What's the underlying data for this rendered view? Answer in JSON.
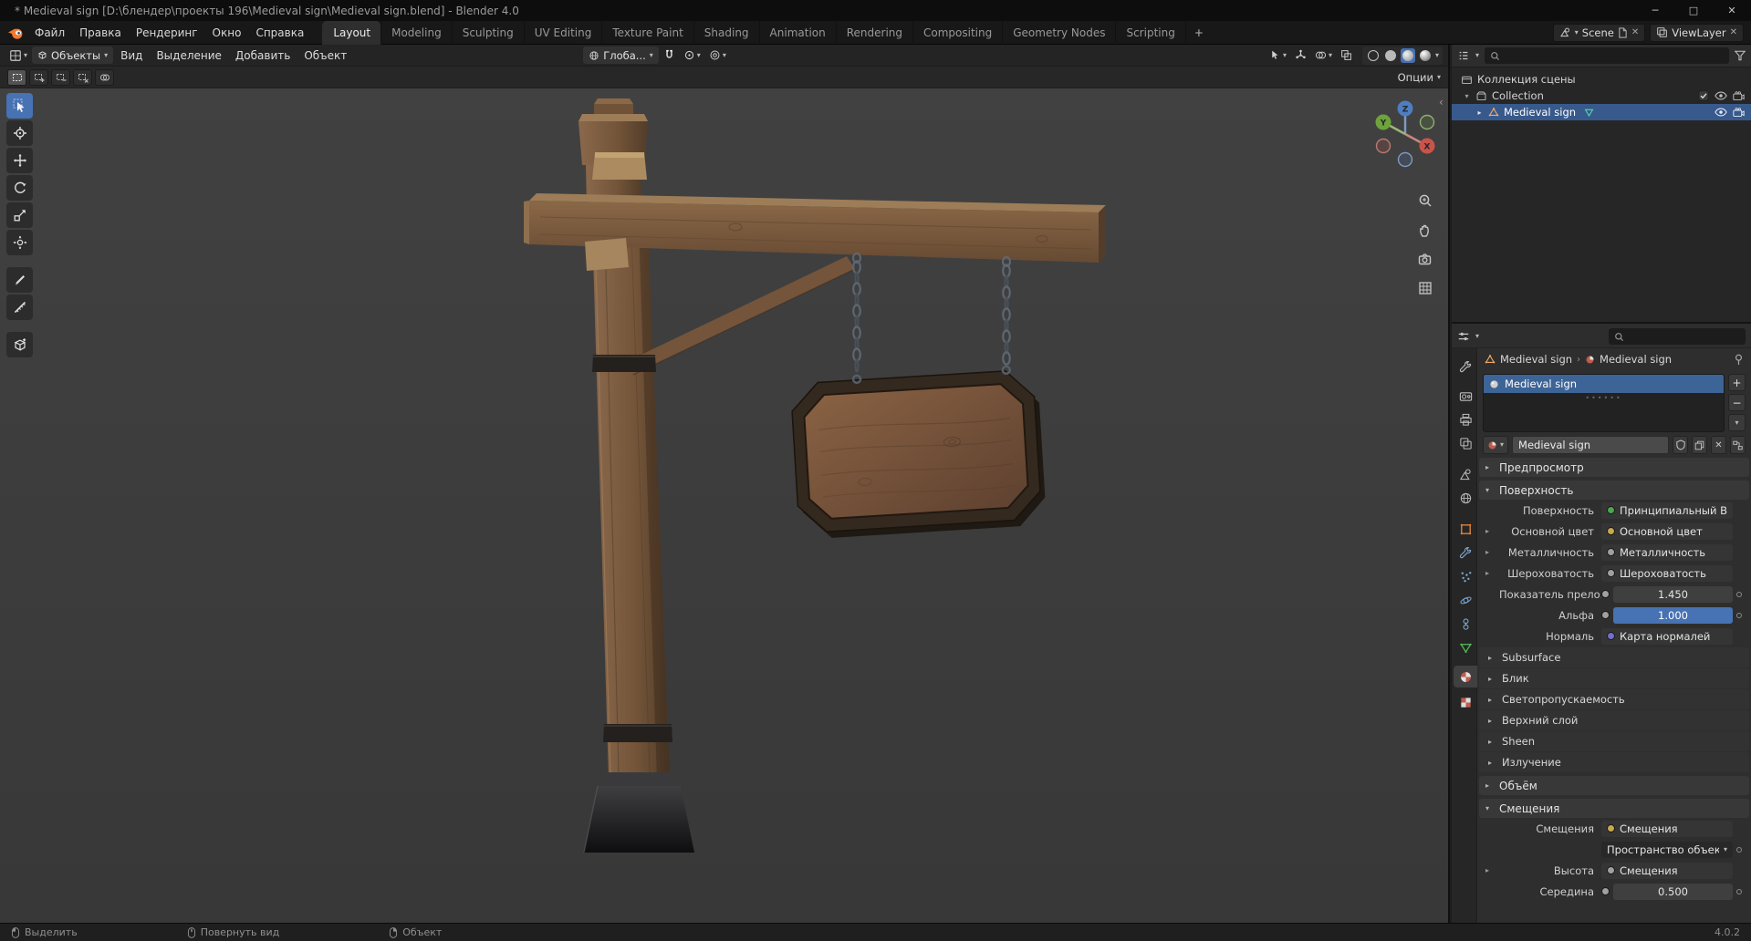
{
  "colors": {
    "accent": "#4772b3",
    "selection_row": "#37598c",
    "viewport_bg": "#3d3d3d",
    "socket_shader": "#4ca64c",
    "socket_color": "#c7a84c",
    "socket_float": "#a0a0a0",
    "socket_vector": "#7070c8",
    "object_orange": "#e8883a",
    "data_green": "#55c055",
    "material_red": "#bf5b4d"
  },
  "window": {
    "title": "* Medieval sign [D:\\блендер\\проекты 196\\Medieval sign\\Medieval sign.blend] - Blender 4.0",
    "minimize": "─",
    "maximize": "□",
    "close": "✕"
  },
  "topbar": {
    "menus": [
      {
        "label": "Файл"
      },
      {
        "label": "Правка"
      },
      {
        "label": "Рендеринг"
      },
      {
        "label": "Окно"
      },
      {
        "label": "Справка"
      }
    ],
    "workspaces": [
      {
        "label": "Layout"
      },
      {
        "label": "Modeling"
      },
      {
        "label": "Sculpting"
      },
      {
        "label": "UV Editing"
      },
      {
        "label": "Texture Paint"
      },
      {
        "label": "Shading"
      },
      {
        "label": "Animation"
      },
      {
        "label": "Rendering"
      },
      {
        "label": "Compositing"
      },
      {
        "label": "Geometry Nodes"
      },
      {
        "label": "Scripting"
      }
    ],
    "add_tab": "+",
    "scene": "Scene",
    "viewlayer": "ViewLayer"
  },
  "viewport_header": {
    "mode": "Объекты",
    "menu_view": "Вид",
    "menu_select": "Выделение",
    "menu_add": "Добавить",
    "menu_object": "Объект",
    "orientation": "Глоба...",
    "options": "Опции"
  },
  "gizmo": {
    "x": "X",
    "y": "Y",
    "z": "Z"
  },
  "outliner": {
    "rows": [
      {
        "label": "Коллекция сцены"
      },
      {
        "label": "Collection"
      },
      {
        "label": "Medieval sign"
      }
    ]
  },
  "properties": {
    "breadcrumb_object": "Medieval sign",
    "breadcrumb_separator": "›",
    "breadcrumb_material": "Medieval sign",
    "slot_name": "Medieval sign",
    "slot_add": "+",
    "slot_remove": "−",
    "material_name": "Medieval sign",
    "panel_preview": "Предпросмотр",
    "panel_surface": "Поверхность",
    "surface_rows": [
      {
        "label": "Поверхность",
        "value": "Принципиальный BSDF"
      },
      {
        "label": "Основной цвет",
        "value": "Основной цвет"
      },
      {
        "label": "Металличность",
        "value": "Металличность"
      },
      {
        "label": "Шероховатость",
        "value": "Шероховатость"
      },
      {
        "label": "Показатель прело...",
        "value": "1.450"
      },
      {
        "label": "Альфа",
        "value": "1.000"
      },
      {
        "label": "Нормаль",
        "value": "Карта нормалей"
      }
    ],
    "surface_collapsed": [
      {
        "label": "Subsurface"
      },
      {
        "label": "Блик"
      },
      {
        "label": "Светопропускаемость"
      },
      {
        "label": "Верхний слой"
      },
      {
        "label": "Sheen"
      },
      {
        "label": "Излучение"
      }
    ],
    "panel_volume": "Объём",
    "panel_displacement": "Смещения",
    "displacement_rows": [
      {
        "label": "Смещения",
        "value": "Смещения"
      },
      {
        "label": "",
        "value": "Пространство объекта"
      },
      {
        "label": "Высота",
        "value": "Смещения"
      },
      {
        "label": "Середина",
        "value": "0.500"
      }
    ]
  },
  "statusbar": {
    "hint_select": "Выделить",
    "hint_rotate": "Повернуть вид",
    "hint_object": "Объект",
    "version": "4.0.2"
  }
}
